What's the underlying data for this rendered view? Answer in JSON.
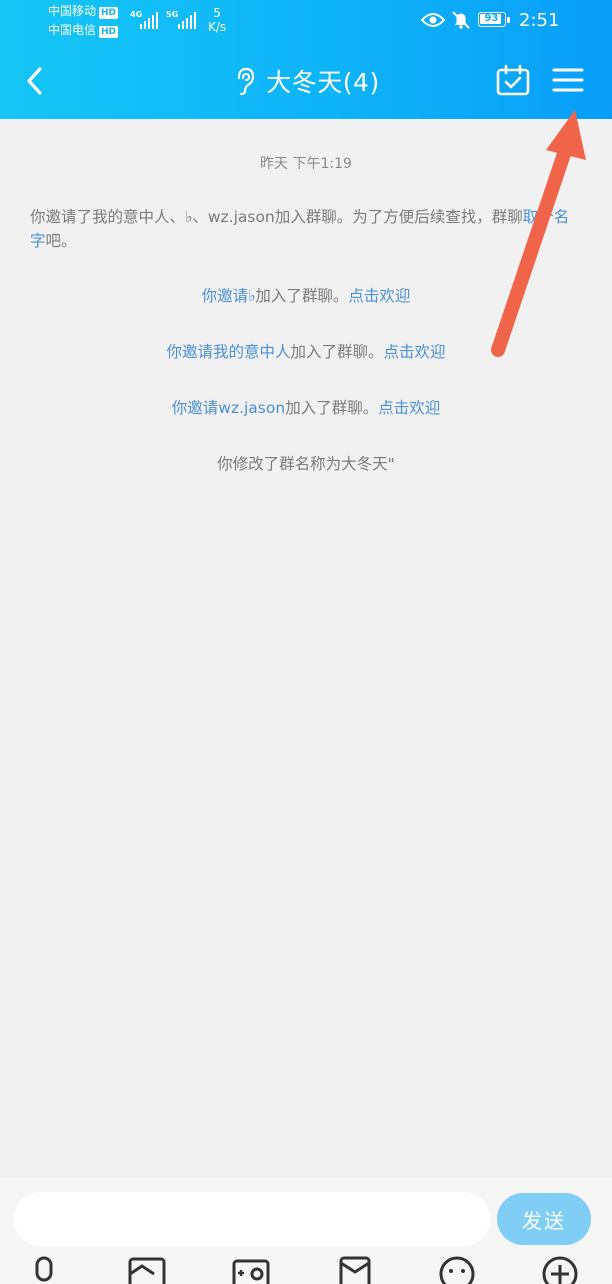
{
  "status_bar": {
    "carrier1": "中国移动",
    "carrier2": "中国电信",
    "hd_badge": "HD",
    "net1": "4G",
    "net2": "5G",
    "speed_value": "5",
    "speed_unit": "K/s",
    "battery": "93",
    "battery_level": 0.93,
    "time": "2:51"
  },
  "header": {
    "title": "大冬天(4)"
  },
  "chat": {
    "timestamp": "昨天 下午1:19",
    "invite_notice_a": "你邀请了我的意中人、",
    "invite_notice_flat": "♭",
    "invite_notice_b": "、wz.jason加入群聊。为了方便后续查找，",
    "invite_notice_c": "群聊",
    "invite_notice_link": "取个名字",
    "invite_notice_end": "吧。",
    "msg1_prefix": "你邀请",
    "msg1_name": "♭",
    "msg1_mid": "加入了群聊。",
    "msg1_link": "点击欢迎",
    "msg2_prefix": "你邀请",
    "msg2_name": "我的意中人",
    "msg2_mid": "加入了群聊。",
    "msg2_link": "点击欢迎",
    "msg3_prefix": "你邀请",
    "msg3_name": "wz.jason",
    "msg3_mid": "加入了群聊。",
    "msg3_link": "点击欢迎",
    "rename_notice": "你修改了群名称为大冬天\""
  },
  "composer": {
    "input_value": "",
    "send_label": "发送"
  },
  "toolbar": {
    "icons": [
      "microphone-icon",
      "image-icon",
      "camera-icon",
      "red-packet-icon",
      "emoji-icon",
      "plus-icon"
    ]
  },
  "colors": {
    "header_start": "#15c6f6",
    "header_end": "#0a9ef9",
    "link": "#4a8fd7",
    "send_button": "#80cdf6",
    "annotation_arrow": "#f0654a"
  }
}
